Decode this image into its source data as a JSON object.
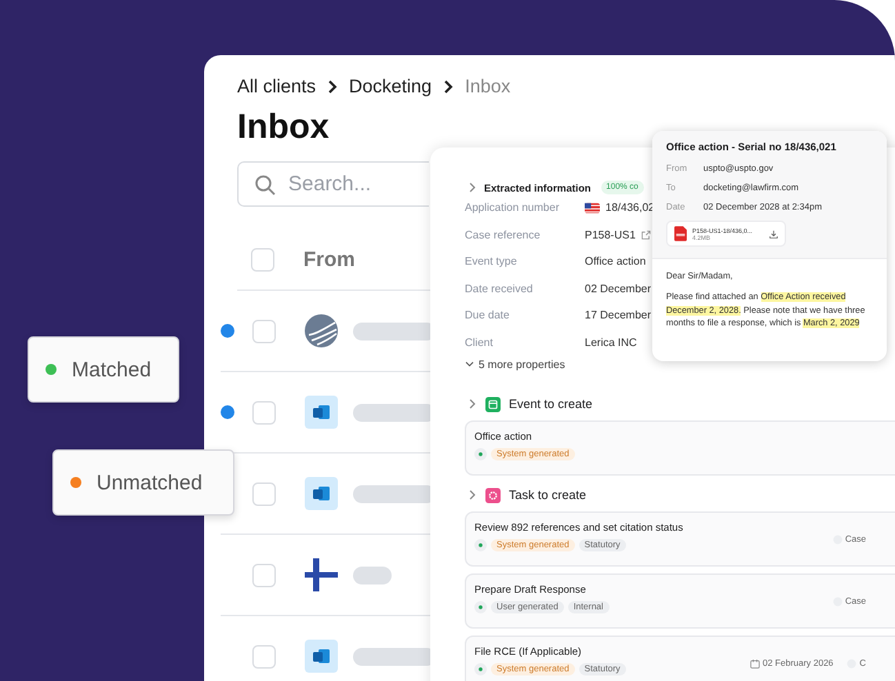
{
  "status_badges": [
    {
      "label": "Matched",
      "color": "#3dbf55"
    },
    {
      "label": "Unmatched",
      "color": "#f57f20"
    }
  ],
  "inbox": {
    "breadcrumb": [
      "All clients",
      "Docketing",
      "Inbox"
    ],
    "title": "Inbox",
    "search": {
      "placeholder": "Search..."
    },
    "column": "From",
    "header_checked": false,
    "rows": [
      {
        "unread": true,
        "checked": false,
        "kind": "globe"
      },
      {
        "unread": true,
        "checked": false,
        "kind": "mail"
      },
      {
        "unread": false,
        "checked": false,
        "kind": "mail"
      },
      {
        "unread": false,
        "checked": false,
        "kind": "flag"
      },
      {
        "unread": false,
        "checked": false,
        "kind": "mail"
      }
    ]
  },
  "details": {
    "heading": "Extracted information",
    "confidence": "100% co",
    "properties": [
      {
        "label": "Application number",
        "value": "18/436,02",
        "kind": "flag"
      },
      {
        "label": "Case reference",
        "value": "P158-US1",
        "kind": "link"
      },
      {
        "label": "Event type",
        "value": "Office action",
        "kind": "text"
      },
      {
        "label": "Date received",
        "value": "02 December",
        "kind": "text"
      },
      {
        "label": "Due date",
        "value": "17 December",
        "kind": "text"
      },
      {
        "label": "Client",
        "value": "Lerica INC",
        "kind": "text"
      }
    ],
    "more": "5 more properties",
    "event_heading": "Event to create",
    "events": [
      {
        "title": "Office action",
        "tags": [
          {
            "text": "System generated",
            "kind": "system"
          }
        ]
      }
    ],
    "task_heading": "Task to create",
    "tasks": [
      {
        "title": "Review 892 references and set citation status",
        "tags": [
          {
            "text": "System generated",
            "kind": "system"
          },
          {
            "text": "Statutory",
            "kind": "plain"
          }
        ],
        "assignee": "Case"
      },
      {
        "title": "Prepare Draft Response",
        "tags": [
          {
            "text": "User generated",
            "kind": "plain"
          },
          {
            "text": "Internal",
            "kind": "plain"
          }
        ],
        "assignee": "Case"
      },
      {
        "title": "File RCE (If Applicable)",
        "tags": [
          {
            "text": "System generated",
            "kind": "system"
          },
          {
            "text": "Statutory",
            "kind": "plain"
          }
        ],
        "date": "02 February 2026",
        "assignee": "C"
      }
    ]
  },
  "email": {
    "title": "Office action - Serial no 18/436,021",
    "fields": [
      {
        "label": "From",
        "value": "uspto@uspto.gov"
      },
      {
        "label": "To",
        "value": "docketing@lawfirm.com"
      },
      {
        "label": "Date",
        "value": "02 December 2028 at 2:34pm"
      }
    ],
    "attachment": {
      "name": "P158-US1-18/436,0...",
      "size": "4.2MB"
    },
    "greeting": "Dear Sir/Madam,",
    "body": [
      {
        "text": "Please find attached an ",
        "highlighted": false
      },
      {
        "text": "Office Action received December 2, 2028.",
        "highlighted": true
      },
      {
        "text": " Please note that we have three months to file a response, which is ",
        "highlighted": false
      },
      {
        "text": "March 2, 2029",
        "highlighted": true
      }
    ]
  }
}
